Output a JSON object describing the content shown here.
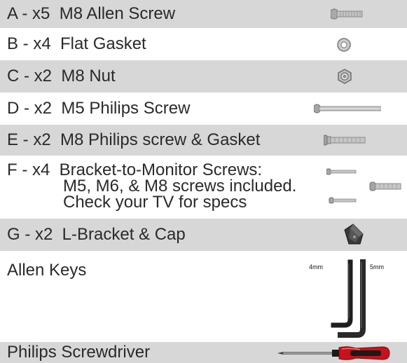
{
  "rows": [
    {
      "label": "A - x5  M8 Allen Screw",
      "icon": "allen-screw-icon"
    },
    {
      "label": "B - x4  Flat Gasket",
      "icon": "flat-gasket-icon"
    },
    {
      "label": "C - x2  M8 Nut",
      "icon": "nut-icon"
    },
    {
      "label": "D - x2  M5 Philips Screw",
      "icon": "long-screw-icon"
    },
    {
      "label": "E - x2  M8 Philips screw & Gasket",
      "icon": "screw-gasket-icon"
    },
    {
      "lines": [
        "F - x4  Bracket-to-Monitor Screws:",
        "M5, M6, & M8 screws included.",
        "Check your TV for specs"
      ],
      "icon": "bracket-screws-icon"
    },
    {
      "label": "G - x2  L-Bracket & Cap",
      "icon": "l-bracket-icon"
    },
    {
      "label": "Allen Keys",
      "icon": "allen-keys-icon",
      "key_sizes": [
        "4mm",
        "5mm"
      ]
    },
    {
      "label": "Philips Screwdriver",
      "icon": "screwdriver-icon"
    }
  ],
  "colors": {
    "row_gray": "#d7d7d7",
    "row_white": "#ffffff",
    "metal": "#b8b8b8",
    "handle_red": "#c8121a"
  }
}
